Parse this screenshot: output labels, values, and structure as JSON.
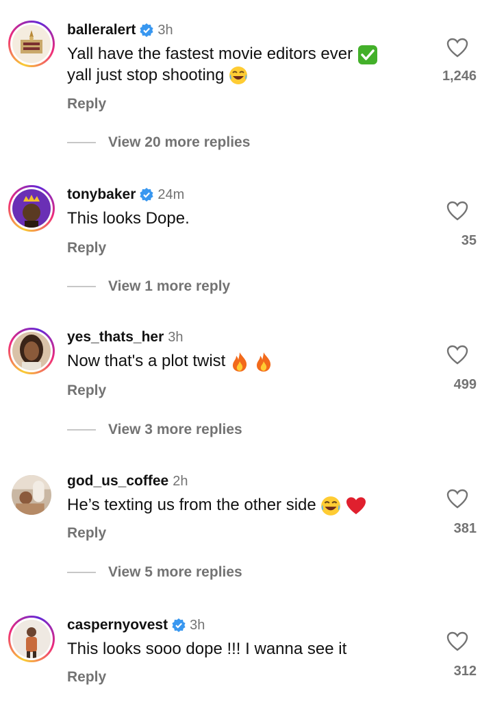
{
  "comments": [
    {
      "username": "balleralert",
      "verified": true,
      "time": "3h",
      "text_line1": "Yall have the fastest movie editors ever",
      "text_line2": "yall just stop shooting",
      "reply": "Reply",
      "likes": "1,246",
      "view_replies": "View 20 more replies"
    },
    {
      "username": "tonybaker",
      "verified": true,
      "time": "24m",
      "text": "This looks Dope.",
      "reply": "Reply",
      "likes": "35",
      "view_replies": "View 1 more reply"
    },
    {
      "username": "yes_thats_her",
      "verified": false,
      "time": "3h",
      "text": "Now that's a plot twist",
      "reply": "Reply",
      "likes": "499",
      "view_replies": "View 3 more replies"
    },
    {
      "username": "god_us_coffee",
      "verified": false,
      "time": "2h",
      "text": "He’s texting us from the other side",
      "reply": "Reply",
      "likes": "381",
      "view_replies": "View 5 more replies"
    },
    {
      "username": "caspernyovest",
      "verified": true,
      "time": "3h",
      "text": "This looks sooo dope !!! I wanna see it",
      "reply": "Reply",
      "likes": "312"
    }
  ],
  "colors": {
    "secondary_text": "#737373",
    "verified_blue": "#3897f0",
    "story_ring": "#ee2a7b"
  }
}
